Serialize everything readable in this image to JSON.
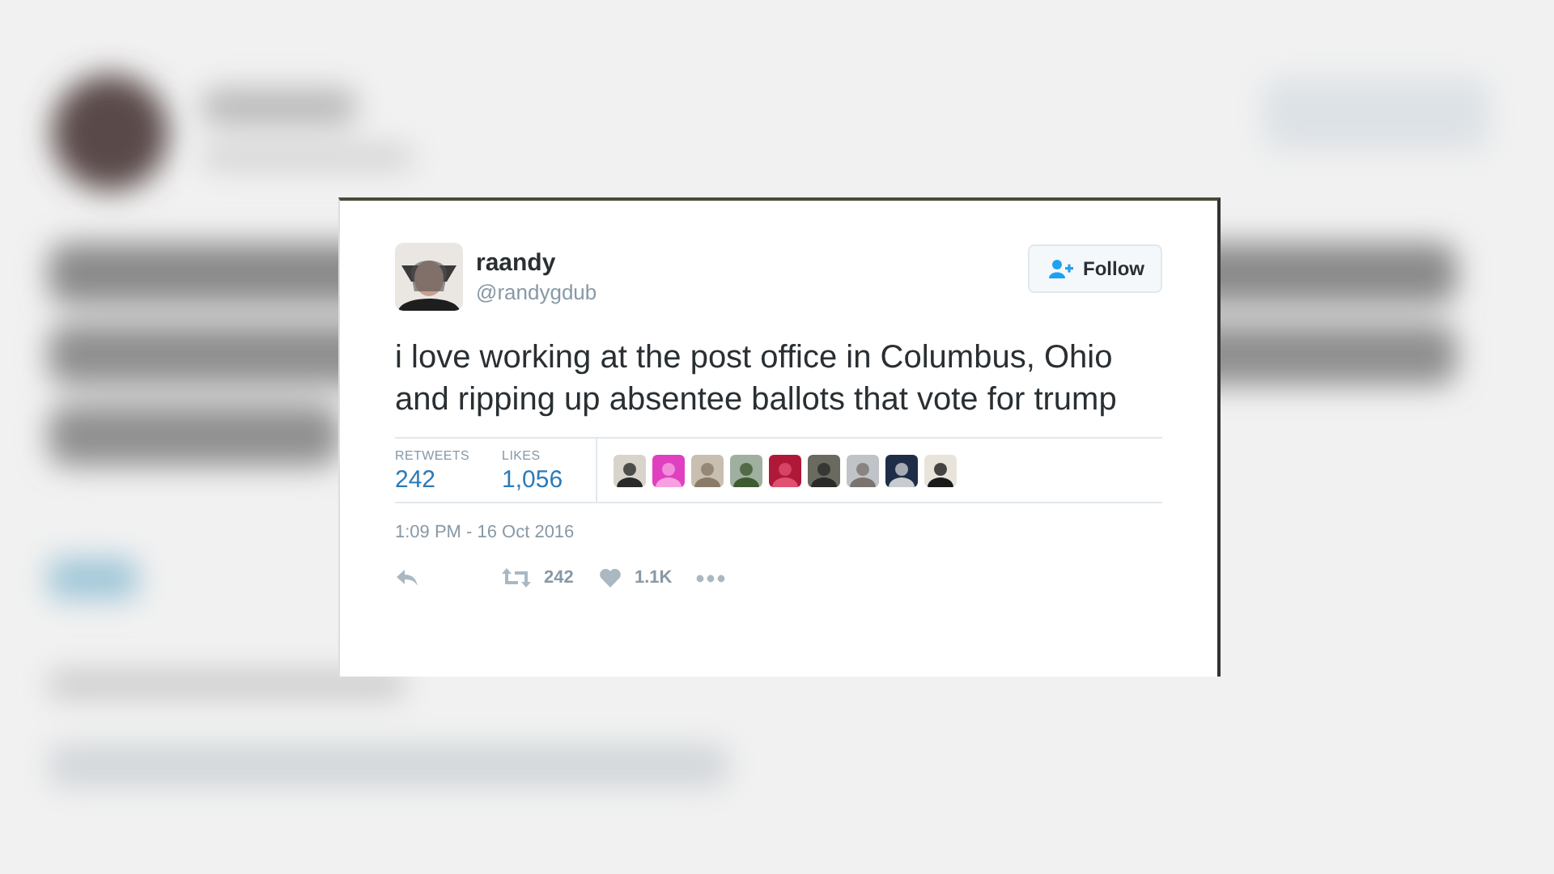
{
  "tweet": {
    "name": "raandy",
    "handle": "@randygdub",
    "follow_button": "Follow",
    "text": "i love working at the post office in Columbus, Ohio and ripping up absentee ballots that vote for trump",
    "stats": [
      {
        "label": "RETWEETS",
        "value": "242"
      },
      {
        "label": "LIKES",
        "value": "1,056"
      }
    ],
    "timestamp": "1:09 PM - 16 Oct 2016",
    "actions": [
      {
        "kind": "reply"
      },
      {
        "kind": "retweet",
        "count": "242"
      },
      {
        "kind": "like",
        "count": "1.1K"
      },
      {
        "kind": "more"
      }
    ]
  }
}
